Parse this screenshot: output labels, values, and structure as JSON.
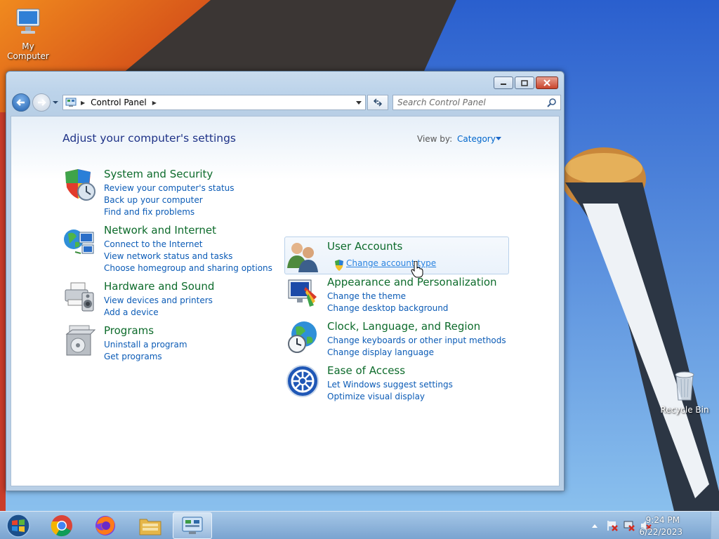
{
  "desktop": {
    "icons": [
      {
        "label": "My Computer"
      },
      {
        "label": "Recycle Bin"
      }
    ]
  },
  "window": {
    "address": {
      "location": "Control Panel"
    },
    "search": {
      "placeholder": "Search Control Panel"
    },
    "title": "Adjust your computer's settings",
    "view_by": {
      "label": "View by:",
      "value": "Category"
    },
    "categories_left": [
      {
        "title": "System and Security",
        "icon": "shield-icon",
        "links": [
          "Review your computer's status",
          "Back up your computer",
          "Find and fix problems"
        ]
      },
      {
        "title": "Network and Internet",
        "icon": "network-globe-icon",
        "links": [
          "Connect to the Internet",
          "View network status and tasks",
          "Choose homegroup and sharing options"
        ]
      },
      {
        "title": "Hardware and Sound",
        "icon": "printer-speaker-icon",
        "links": [
          "View devices and printers",
          "Add a device"
        ]
      },
      {
        "title": "Programs",
        "icon": "programs-box-icon",
        "links": [
          "Uninstall a program",
          "Get programs"
        ]
      }
    ],
    "categories_right": [
      {
        "title": "User Accounts",
        "icon": "users-icon",
        "links": [
          "Change account type"
        ]
      },
      {
        "title": "Appearance and Personalization",
        "icon": "display-paint-icon",
        "links": [
          "Change the theme",
          "Change desktop background"
        ]
      },
      {
        "title": "Clock, Language, and Region",
        "icon": "clock-globe-icon",
        "links": [
          "Change keyboards or other input methods",
          "Change display language"
        ]
      },
      {
        "title": "Ease of Access",
        "icon": "ease-of-access-icon",
        "links": [
          "Let Windows suggest settings",
          "Optimize visual display"
        ]
      }
    ]
  },
  "taskbar": {
    "apps": [
      "start-orb-icon",
      "chrome-icon",
      "firefox-icon",
      "file-explorer-icon",
      "control-panel-icon"
    ],
    "clock": {
      "time": "9:24 PM",
      "date": "6/22/2023"
    }
  },
  "colors": {
    "category_title": "#0d6b2b",
    "link": "#0b5bb6",
    "page_title": "#1e3287"
  }
}
